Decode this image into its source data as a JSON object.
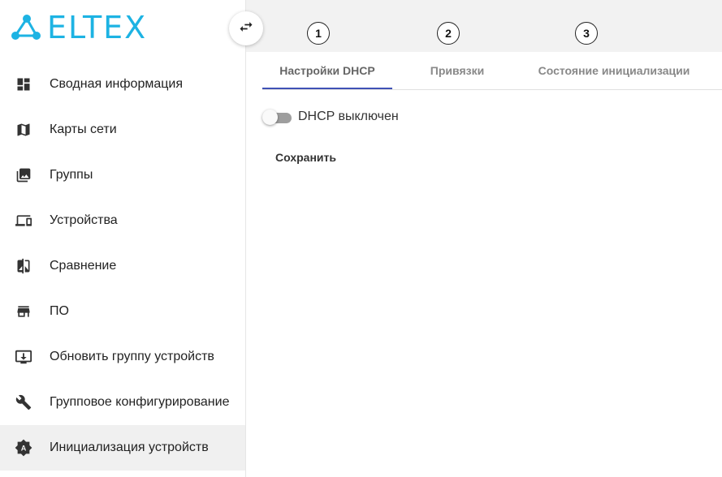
{
  "brand": {
    "logo_text": "ELTEX",
    "color": "#1db3e3"
  },
  "sidebar": {
    "items": [
      {
        "label": "Сводная информация",
        "icon": "dashboard-icon"
      },
      {
        "label": "Карты сети",
        "icon": "map-icon"
      },
      {
        "label": "Группы",
        "icon": "photo-library-icon"
      },
      {
        "label": "Устройства",
        "icon": "devices-icon"
      },
      {
        "label": "Сравнение",
        "icon": "compare-icon"
      },
      {
        "label": "ПО",
        "icon": "store-icon"
      },
      {
        "label": "Обновить группу устройств",
        "icon": "system-update-icon"
      },
      {
        "label": "Групповое конфигурирование",
        "icon": "wrench-icon"
      },
      {
        "label": "Инициализация устройств",
        "icon": "brightness-auto-icon",
        "active": true
      }
    ]
  },
  "tabs": [
    {
      "label": "Настройки DHCP",
      "marker": "1",
      "active": true
    },
    {
      "label": "Привязки",
      "marker": "2"
    },
    {
      "label": "Состояние инициализации",
      "marker": "3"
    }
  ],
  "dhcp": {
    "toggle_label": "DHCP выключен",
    "enabled": false
  },
  "actions": {
    "save_label": "Сохранить"
  },
  "colors": {
    "accent": "#3f51b5",
    "active_nav_bg": "#f0f0f0"
  }
}
